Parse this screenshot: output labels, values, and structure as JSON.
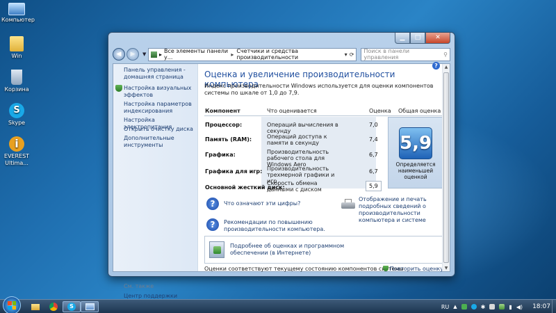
{
  "desktop": {
    "icons": [
      {
        "label": "Компьютер",
        "icon": "computer-icon"
      },
      {
        "label": "Win",
        "icon": "folder-icon"
      },
      {
        "label": "Корзина",
        "icon": "recycle-bin-icon"
      },
      {
        "label": "Skype",
        "icon": "skype-icon"
      },
      {
        "label": "EVEREST Ultima...",
        "icon": "everest-icon"
      }
    ]
  },
  "window": {
    "breadcrumb": [
      "Все элементы панели у...",
      "Счетчики и средства производительности"
    ],
    "search_placeholder": "Поиск в панели управления",
    "sidebar": {
      "items": [
        "Панель управления - домашняя страница",
        "Настройка визуальных эффектов",
        "Настройка параметров индексирования",
        "Настройка электропитания",
        "Открыть очистку диска",
        "Дополнительные инструменты"
      ],
      "see_also": "См. также",
      "see_also_items": [
        "Центр поддержки"
      ]
    },
    "main": {
      "title": "Оценка и увеличение производительности компьютера",
      "description": "Индекс производительности Windows используется для оценки компонентов системы по шкале от 1,0 до 7,9.",
      "columns": [
        "Компонент",
        "Что оценивается",
        "Оценка",
        "Общая оценка"
      ],
      "rows": [
        {
          "component": "Процессор:",
          "measures": "Операций вычисления в секунду",
          "score": "7,0"
        },
        {
          "component": "Память (RAM):",
          "measures": "Операций доступа к памяти в секунду",
          "score": "7,4"
        },
        {
          "component": "Графика:",
          "measures": "Производительность рабочего стола для Windows Aero",
          "score": "6,7"
        },
        {
          "component": "Графика для игр:",
          "measures": "Производительность трехмерной графики и игр",
          "score": "6,7"
        },
        {
          "component": "Основной жесткий диск:",
          "measures": "Скорость обмена данными с диском",
          "score": "5,9"
        }
      ],
      "base_score": "5,9",
      "base_score_note": "Определяется наименьшей оценкой",
      "links": {
        "what_mean": "Что означают эти цифры?",
        "print": "Отображение и печать подробных сведений о производительности компьютера и системе",
        "tips": "Рекомендации по повышению производительности компьютера.",
        "more": "Подробнее об оценках и программном обеспечении (в Интернете)"
      },
      "footer_text": "Оценки соответствуют текущему состоянию компонентов системы",
      "rerun": "Повторить оценку"
    }
  },
  "taskbar": {
    "lang": "RU",
    "time": "18:07"
  },
  "colors": {
    "link": "#1e3f72",
    "title": "#1f4e9e",
    "badge": "#1f63b7"
  }
}
